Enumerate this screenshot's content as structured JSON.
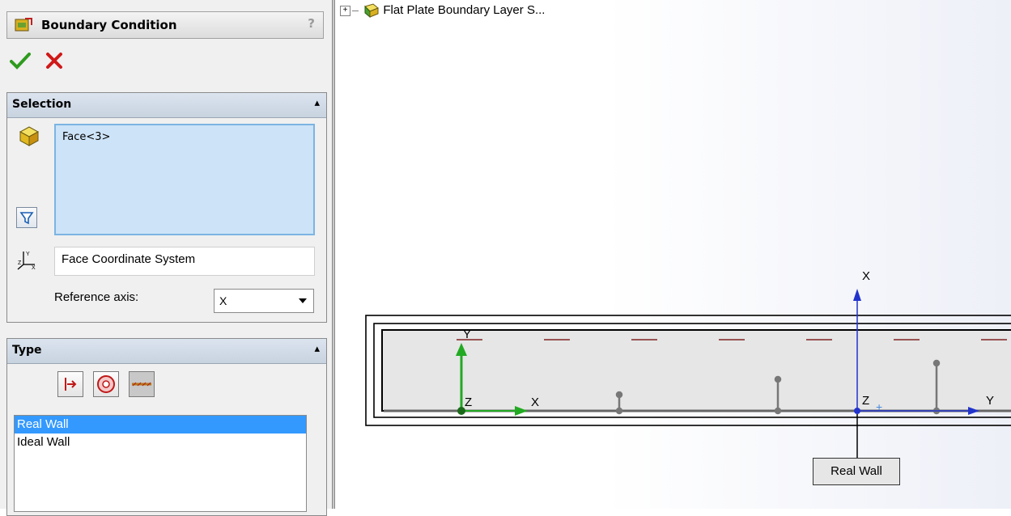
{
  "panel": {
    "title": "Boundary Condition",
    "help": "?",
    "selection": {
      "header": "Selection",
      "items": [
        "Face<3>"
      ],
      "coordinate_system": "Face Coordinate System",
      "reference_axis_label": "Reference axis:",
      "reference_axis_value": "X"
    },
    "type": {
      "header": "Type",
      "list": [
        "Real Wall",
        "Ideal Wall"
      ],
      "selected": "Real Wall"
    }
  },
  "graphics": {
    "tree_item": "Flat Plate Boundary Layer S...",
    "triad": {
      "x": "X",
      "y": "Y",
      "z": "Z"
    },
    "face_triad": {
      "x": "X",
      "y": "Y",
      "z": "Z"
    },
    "callout": "Real Wall"
  },
  "colors": {
    "selection_bg": "#cde3f7",
    "list_highlight": "#3399ff",
    "axis_blue": "#2233cc",
    "axis_green": "#22aa22"
  }
}
